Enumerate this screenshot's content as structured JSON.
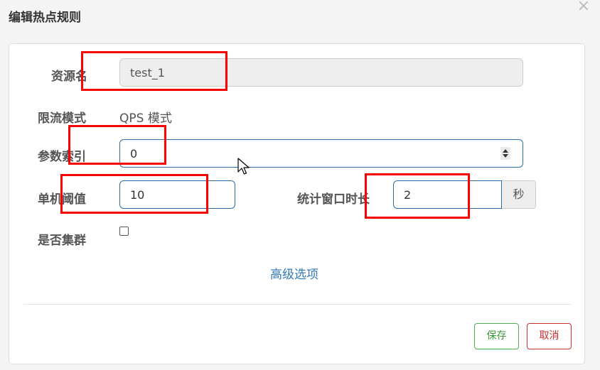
{
  "dialog": {
    "title": "编辑热点规则",
    "close_symbol": "×"
  },
  "form": {
    "resource_label": "资源名",
    "resource_value": "test_1",
    "flow_mode_label": "限流模式",
    "flow_mode_value": "QPS 模式",
    "param_index_label": "参数索引",
    "param_index_value": "0",
    "threshold_label": "单机阈值",
    "threshold_value": "10",
    "window_label": "统计窗口时长",
    "window_value": "2",
    "window_unit": "秒",
    "cluster_label": "是否集群",
    "cluster_checked": false,
    "advanced_link": "高级选项"
  },
  "footer": {
    "save_label": "保存",
    "cancel_label": "取消"
  },
  "colors": {
    "accent": "#337ab7",
    "save": "#3c9a3c",
    "cancel": "#c9302c",
    "highlight": "#ff0000"
  }
}
